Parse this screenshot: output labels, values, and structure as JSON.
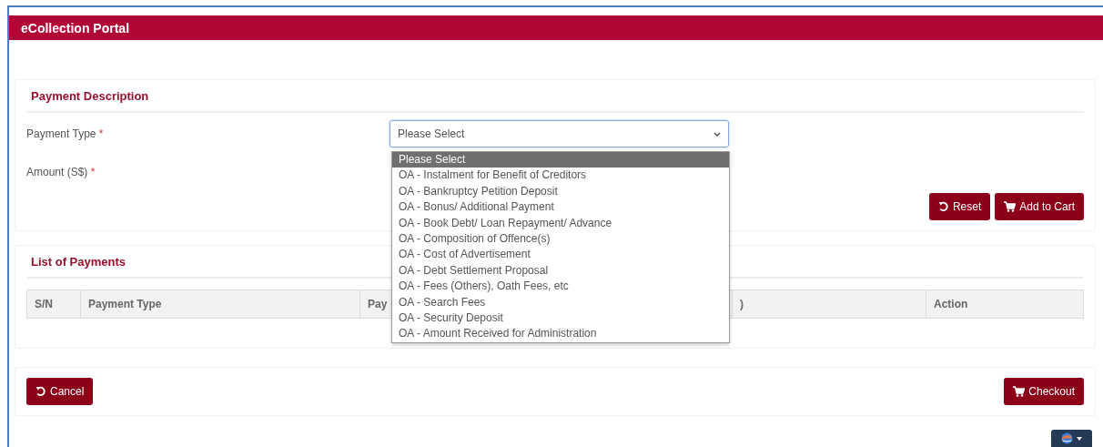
{
  "header": {
    "title": "eCollection Portal"
  },
  "payment_description": {
    "title": "Payment Description",
    "fields": [
      {
        "label": "Payment Type",
        "required_mark": "*",
        "kind": "select"
      },
      {
        "label": "Amount (S$)",
        "required_mark": "*",
        "kind": "hidden"
      }
    ],
    "payment_type_select": {
      "value": "Please Select",
      "expanded": true,
      "options": [
        {
          "label": "Please Select",
          "selected": true
        },
        {
          "label": "OA - Instalment for Benefit of Creditors",
          "selected": false
        },
        {
          "label": "OA - Bankruptcy Petition Deposit",
          "selected": false
        },
        {
          "label": "OA - Bonus/ Additional Payment",
          "selected": false
        },
        {
          "label": "OA - Book Debt/ Loan Repayment/ Advance",
          "selected": false
        },
        {
          "label": "OA - Composition of Offence(s)",
          "selected": false
        },
        {
          "label": "OA - Cost of Advertisement",
          "selected": false
        },
        {
          "label": "OA - Debt Settlement Proposal",
          "selected": false
        },
        {
          "label": "OA - Fees (Others), Oath Fees, etc",
          "selected": false
        },
        {
          "label": "OA - Search Fees",
          "selected": false
        },
        {
          "label": "OA - Security Deposit",
          "selected": false
        },
        {
          "label": "OA - Amount Received for Administration",
          "selected": false
        }
      ]
    },
    "buttons": [
      {
        "label": "Reset",
        "kind": "reset"
      },
      {
        "label": "Add to Cart",
        "kind": "cart"
      }
    ]
  },
  "list_of_payments": {
    "title": "List of Payments",
    "columns": [
      "S/N",
      "Payment Type",
      "Pay",
      ")",
      "Action"
    ]
  },
  "footer": {
    "buttons": [
      {
        "label": "Cancel",
        "kind": "reset"
      },
      {
        "label": "Checkout",
        "kind": "cart"
      }
    ]
  }
}
